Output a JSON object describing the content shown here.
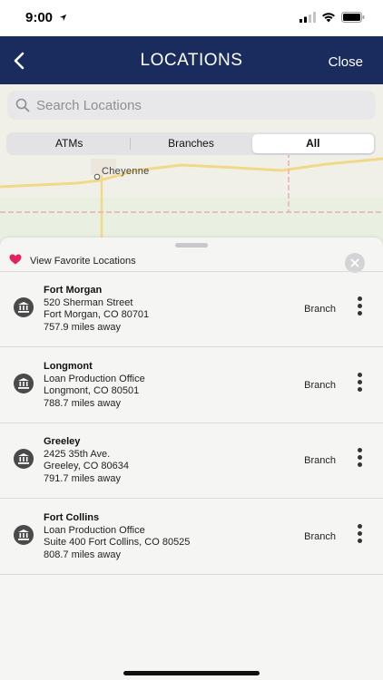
{
  "status_bar": {
    "time": "9:00"
  },
  "nav": {
    "title": "LOCATIONS",
    "close_label": "Close"
  },
  "search": {
    "placeholder": "Search Locations"
  },
  "filters": [
    "ATMs",
    "Branches",
    "All"
  ],
  "map": {
    "city_label": "Cheyenne"
  },
  "favorites": {
    "label": "View Favorite Locations"
  },
  "locations": [
    {
      "name": "Fort Morgan",
      "line1": "520 Sherman Street",
      "line2": "Fort Morgan, CO 80701",
      "distance": "757.9 miles away",
      "type": "Branch"
    },
    {
      "name": "Longmont",
      "line1": "Loan Production Office",
      "line2": "Longmont, CO 80501",
      "distance": "788.7 miles away",
      "type": "Branch"
    },
    {
      "name": "Greeley",
      "line1": "2425 35th Ave.",
      "line2": "Greeley, CO 80634",
      "distance": "791.7 miles away",
      "type": "Branch"
    },
    {
      "name": "Fort Collins",
      "line1": "Loan Production Office",
      "line2": "Suite 400 Fort Collins, CO 80525",
      "distance": "808.7 miles away",
      "type": "Branch"
    }
  ],
  "colors": {
    "nav_bg": "#1a2c5e",
    "heart": "#e0245e"
  }
}
